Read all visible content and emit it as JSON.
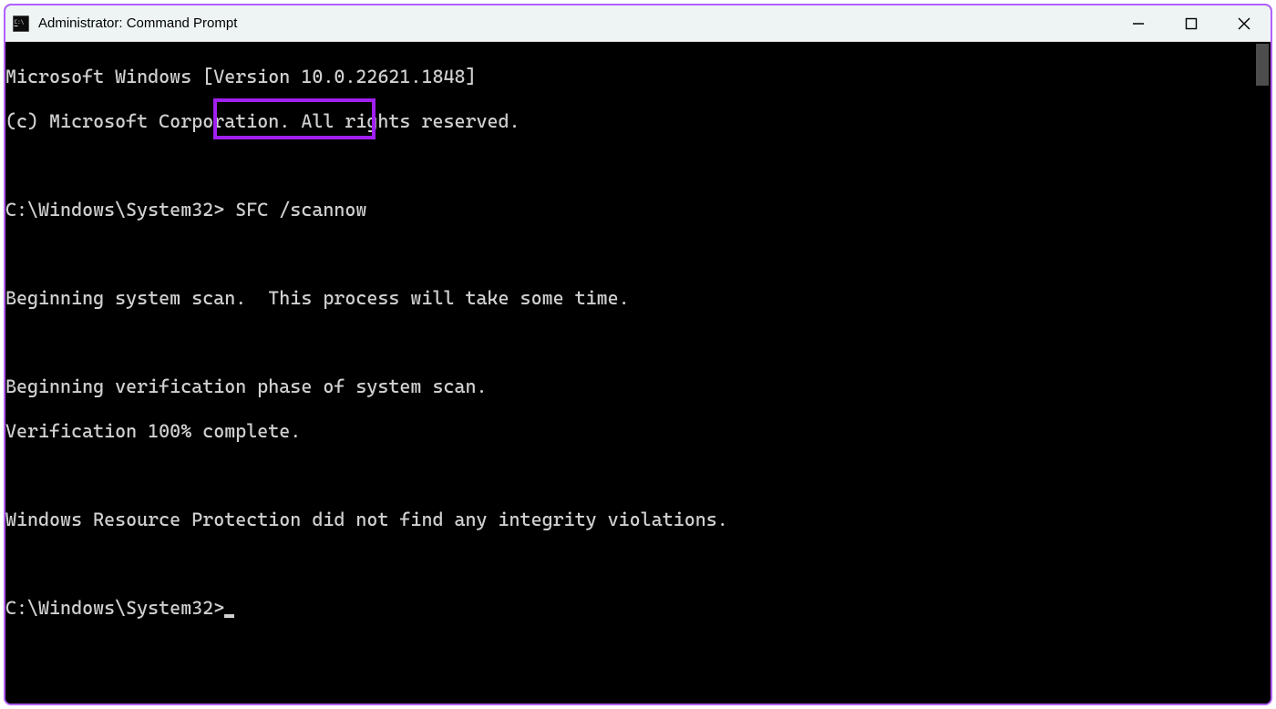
{
  "window": {
    "title": "Administrator: Command Prompt",
    "icon_name": "cmd-icon"
  },
  "terminal": {
    "header_line_1": "Microsoft Windows [Version 10.0.22621.1848]",
    "header_line_2": "(c) Microsoft Corporation. All rights reserved.",
    "prompt_1_path": "C:\\Windows\\System32>",
    "prompt_1_command": "SFC /scannow",
    "out_line_1": "Beginning system scan.  This process will take some time.",
    "out_line_2": "Beginning verification phase of system scan.",
    "out_line_3": "Verification 100% complete.",
    "out_line_4": "Windows Resource Protection did not find any integrity violations.",
    "prompt_2_path": "C:\\Windows\\System32>"
  },
  "highlight": {
    "color": "#a020f0"
  }
}
